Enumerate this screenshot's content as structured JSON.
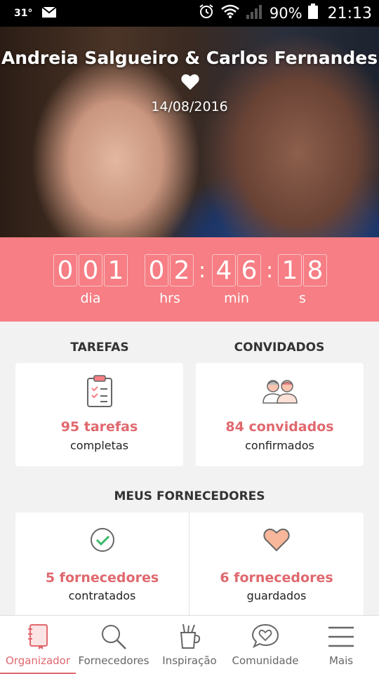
{
  "status_bar": {
    "temperature": "31°",
    "battery_percent": "90%",
    "time": "21:13"
  },
  "hero": {
    "couple_names": "Andreia Salgueiro & Carlos Fernandes",
    "wedding_date": "14/08/2016"
  },
  "countdown": {
    "days": [
      "0",
      "0",
      "1"
    ],
    "hours": [
      "0",
      "2"
    ],
    "minutes": [
      "4",
      "6"
    ],
    "seconds": [
      "1",
      "8"
    ],
    "separator": ":",
    "labels": {
      "days": "dia",
      "hours": "hrs",
      "minutes": "min",
      "seconds": "s"
    }
  },
  "tasks": {
    "title": "TAREFAS",
    "count_label": "95 tarefas",
    "status_label": "completas"
  },
  "guests": {
    "title": "CONVIDADOS",
    "count_label": "84 convidados",
    "status_label": "confirmados"
  },
  "vendors": {
    "title": "MEUS FORNECEDORES",
    "hired": {
      "count_label": "5 fornecedores",
      "status_label": "contratados"
    },
    "saved": {
      "count_label": "6 fornecedores",
      "status_label": "guardados"
    }
  },
  "bottom_nav": {
    "items": [
      {
        "label": "Organizador",
        "icon": "notebook-icon",
        "active": true
      },
      {
        "label": "Fornecedores",
        "icon": "search-icon",
        "active": false
      },
      {
        "label": "Inspiração",
        "icon": "pencil-cup-icon",
        "active": false
      },
      {
        "label": "Comunidade",
        "icon": "chat-heart-icon",
        "active": false
      },
      {
        "label": "Mais",
        "icon": "menu-icon",
        "active": false
      }
    ]
  },
  "colors": {
    "accent": "#f67e84",
    "accent_text": "#e0686e"
  }
}
